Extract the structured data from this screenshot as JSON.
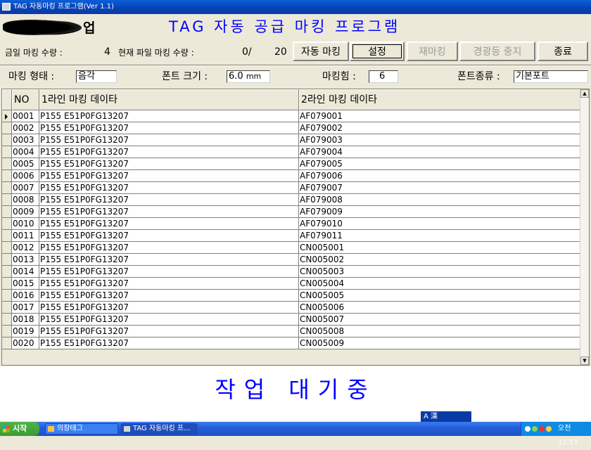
{
  "window": {
    "title": "TAG 자동마킹 프로그램(Ver 1.1)"
  },
  "header": {
    "company_suffix": "업",
    "app_title": "TAG 자동 공급 마킹 프로그램"
  },
  "counts": {
    "today_label": "금일 마킹 수량 :",
    "today_value": "4",
    "file_label": "현재 파일 마킹 수량 :",
    "file_done": "0/",
    "file_total": "20"
  },
  "buttons": {
    "auto_marking": "자동 마킹",
    "settings": "설정",
    "remarking": "재마킹",
    "stop_alarm": "경광등 중지",
    "exit": "종료"
  },
  "settings": {
    "marking_type_label": "마킹 형태 :",
    "marking_type_value": "음각",
    "font_size_label": "폰트 크기 :",
    "font_size_value": "6.0",
    "font_size_unit": "mm",
    "marking_power_label": "마킹힘 :",
    "marking_power_value": "6",
    "font_kind_label": "폰트종류 :",
    "font_kind_value": "기본포트"
  },
  "grid": {
    "columns": [
      "NO",
      "1라인 마킹 데이타",
      "2라인 마킹 데이타"
    ],
    "rows": [
      [
        "0001",
        "P155 E51P0FG13207",
        "AF079001"
      ],
      [
        "0002",
        "P155 E51P0FG13207",
        "AF079002"
      ],
      [
        "0003",
        "P155 E51P0FG13207",
        "AF079003"
      ],
      [
        "0004",
        "P155 E51P0FG13207",
        "AF079004"
      ],
      [
        "0005",
        "P155 E51P0FG13207",
        "AF079005"
      ],
      [
        "0006",
        "P155 E51P0FG13207",
        "AF079006"
      ],
      [
        "0007",
        "P155 E51P0FG13207",
        "AF079007"
      ],
      [
        "0008",
        "P155 E51P0FG13207",
        "AF079008"
      ],
      [
        "0009",
        "P155 E51P0FG13207",
        "AF079009"
      ],
      [
        "0010",
        "P155 E51P0FG13207",
        "AF079010"
      ],
      [
        "0011",
        "P155 E51P0FG13207",
        "AF079011"
      ],
      [
        "0012",
        "P155 E51P0FG13207",
        "CN005001"
      ],
      [
        "0013",
        "P155 E51P0FG13207",
        "CN005002"
      ],
      [
        "0014",
        "P155 E51P0FG13207",
        "CN005003"
      ],
      [
        "0015",
        "P155 E51P0FG13207",
        "CN005004"
      ],
      [
        "0016",
        "P155 E51P0FG13207",
        "CN005005"
      ],
      [
        "0017",
        "P155 E51P0FG13207",
        "CN005006"
      ],
      [
        "0018",
        "P155 E51P0FG13207",
        "CN005007"
      ],
      [
        "0019",
        "P155 E51P0FG13207",
        "CN005008"
      ],
      [
        "0020",
        "P155 E51P0FG13207",
        "CN005009"
      ]
    ],
    "selected_row": 0
  },
  "status": {
    "text": "작업 대기중"
  },
  "ime": {
    "text": "A 漢"
  },
  "taskbar": {
    "start_label": "시작",
    "tasks": [
      "의장태그",
      "TAG 자동마킹 프..."
    ],
    "clock": "오전 12:51"
  },
  "colors": {
    "accent": "#0000ff",
    "face": "#ece9d8",
    "titlebar": "#0841b5"
  },
  "icons": [
    "app-icon",
    "row-indicator-arrow-icon",
    "scroll-up-icon",
    "scroll-down-icon",
    "windows-flag-icon",
    "folder-icon",
    "app-window-icon"
  ]
}
